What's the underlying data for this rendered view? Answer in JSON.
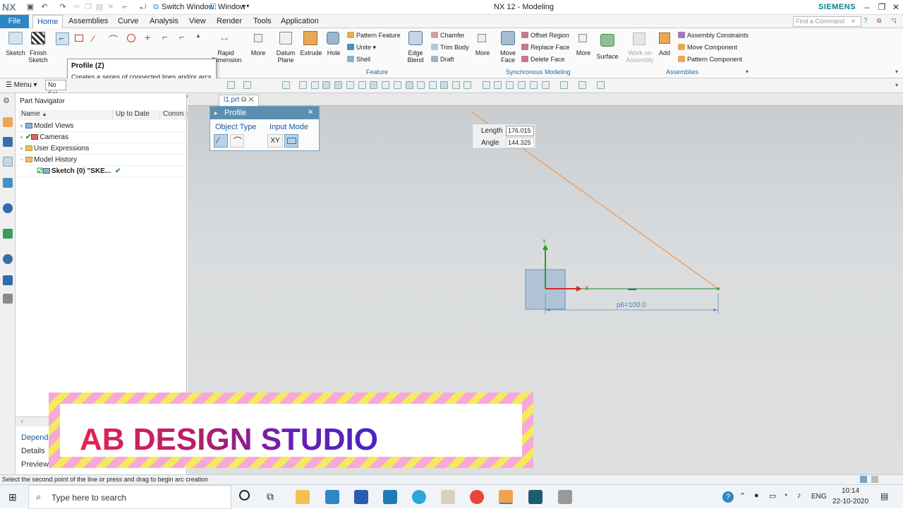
{
  "titlebar": {
    "logo": "NX",
    "switch_window": "Switch Window",
    "window": "Window",
    "title": "NX 12 - Modeling",
    "brand": "SIEMENS"
  },
  "menubar": {
    "file": "File",
    "tabs": [
      "Home",
      "Assemblies",
      "Curve",
      "Analysis",
      "View",
      "Render",
      "Tools",
      "Application"
    ],
    "active_tab": "Home",
    "find_placeholder": "Find a Command"
  },
  "ribbon": {
    "sketch": "Sketch",
    "finish_sketch": "Finish Sketch",
    "rapid_dimension": "Rapid Dimension",
    "more1": "More",
    "datum_plane": "Datum Plane",
    "extrude": "Extrude",
    "hole": "Hole",
    "pattern_feature": "Pattern Feature",
    "unite": "Unite",
    "shell": "Shell",
    "edge_blend": "Edge Blend",
    "chamfer": "Chamfer",
    "trim_body": "Trim Body",
    "draft": "Draft",
    "more2": "More",
    "feature_label": "Feature",
    "move_face": "Move Face",
    "offset_region": "Offset Region",
    "replace_face": "Replace Face",
    "delete_face": "Delete Face",
    "more3": "More",
    "sync_label": "Synchronous Modeling",
    "surface": "Surface",
    "work_on_assembly": "Work on Assembly",
    "add": "Add",
    "assembly_constraints": "Assembly Constraints",
    "move_component": "Move Component",
    "pattern_component": "Pattern Component",
    "assemblies_label": "Assemblies"
  },
  "toolbar2": {
    "menu": "Menu",
    "selection_filter": "No Sel"
  },
  "tooltip": {
    "title": "Profile (Z)",
    "body": "Creates a series of connected lines and/or arcs in string mode; that is, the end of the last curve becomes the beginning of the next curve."
  },
  "navigator": {
    "title": "Part Navigator",
    "columns": [
      "Name",
      "Up to Date",
      "Comm"
    ],
    "items": [
      {
        "label": "Model Views"
      },
      {
        "label": "Cameras"
      },
      {
        "label": "User Expressions"
      },
      {
        "label": "Model History"
      },
      {
        "label": "Sketch (0) \"SKE..."
      }
    ],
    "bottom": [
      "Dependencies",
      "Details",
      "Preview"
    ]
  },
  "part_tab": "l1.prt",
  "profile_dialog": {
    "title": "Profile",
    "object_type": "Object Type",
    "input_mode": "Input Mode",
    "xy": "XY"
  },
  "dims": {
    "length_label": "Length",
    "length_value": "176.015",
    "angle_label": "Angle",
    "angle_value": "144.325"
  },
  "sketch": {
    "dimension_text": "p6=100.0",
    "axis_x": "X",
    "axis_y": "Y"
  },
  "banner": {
    "text": "AB DESIGN STUDIO"
  },
  "status": "Select the second point of the line or press and drag to begin arc creation",
  "taskbar": {
    "search": "Type here to search",
    "lang": "ENG",
    "time": "10:14",
    "date": "22-10-2020"
  },
  "colors": {
    "accent": "#2d87c4",
    "rubber_band_line": "#f08a3a",
    "sketch_line": "#3e9e4b"
  }
}
